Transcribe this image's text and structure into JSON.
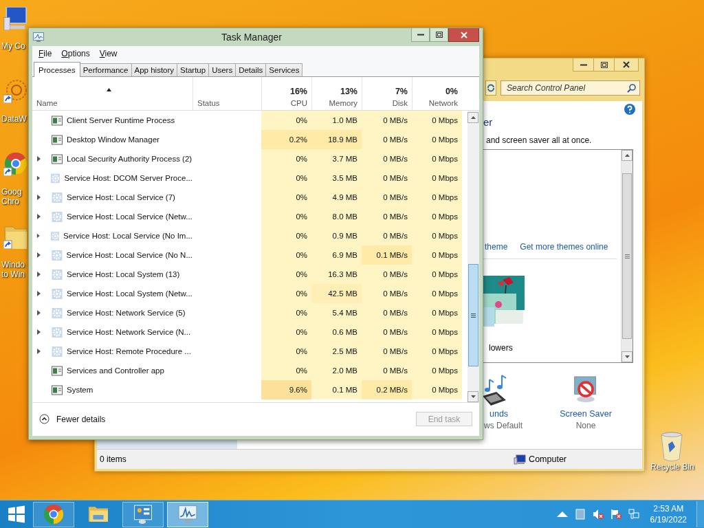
{
  "desktop_icons": [
    {
      "kind": "computer",
      "lines": [
        "My Co"
      ]
    },
    {
      "kind": "datawarehouse",
      "lines": [
        "DataW"
      ]
    },
    {
      "kind": "chrome",
      "lines": [
        "Goog",
        "Chro"
      ]
    },
    {
      "kind": "folder",
      "lines": [
        "Windo",
        "to Win"
      ]
    }
  ],
  "control_panel": {
    "search": {
      "placeholder": "Search Control Panel"
    },
    "heading": "er",
    "description": "and screen saver all at once.",
    "theme_links": [
      "theme",
      "Get more themes online"
    ],
    "theme": {
      "name": "lowers"
    },
    "settings": [
      {
        "kind": "sounds",
        "label": "unds",
        "value": "ws Default"
      },
      {
        "kind": "screen_saver",
        "label": "Screen Saver",
        "value": "None"
      }
    ],
    "status_bar": {
      "items": "0 items",
      "location": "Computer"
    }
  },
  "task_manager": {
    "title": "Task Manager",
    "menu": [
      "File",
      "Options",
      "View"
    ],
    "tabs": [
      {
        "label": "Processes",
        "selected": true
      },
      {
        "label": "Performance",
        "selected": false
      },
      {
        "label": "App history",
        "selected": false
      },
      {
        "label": "Startup",
        "selected": false
      },
      {
        "label": "Users",
        "selected": false
      },
      {
        "label": "Details",
        "selected": false
      },
      {
        "label": "Services",
        "selected": false
      }
    ],
    "name_column": {
      "label": "Name"
    },
    "status_column": {
      "label": "Status"
    },
    "metric_columns": [
      {
        "label": "CPU",
        "total": "16%"
      },
      {
        "label": "Memory",
        "total": "13%"
      },
      {
        "label": "Disk",
        "total": "7%"
      },
      {
        "label": "Network",
        "total": "0%"
      }
    ],
    "rows": [
      {
        "name": "Client Server Runtime Process",
        "kind": "window",
        "expandable": false,
        "cells": [
          {
            "text": "0%",
            "color": "#fff4c4"
          },
          {
            "text": "1.0 MB",
            "color": "#fff4c4"
          },
          {
            "text": "0 MB/s",
            "color": "#fff4c4"
          },
          {
            "text": "0 Mbps",
            "color": "#fff4c4"
          }
        ]
      },
      {
        "name": "Desktop Window Manager",
        "kind": "window",
        "expandable": false,
        "cells": [
          {
            "text": "0.2%",
            "color": "#ffeaa8"
          },
          {
            "text": "18.9 MB",
            "color": "#ffeaa8"
          },
          {
            "text": "0 MB/s",
            "color": "#fff4c4"
          },
          {
            "text": "0 Mbps",
            "color": "#fff4c4"
          }
        ]
      },
      {
        "name": "Local Security Authority Process (2)",
        "kind": "window",
        "expandable": true,
        "cells": [
          {
            "text": "0%",
            "color": "#fff4c4"
          },
          {
            "text": "3.7 MB",
            "color": "#fff4c4"
          },
          {
            "text": "0 MB/s",
            "color": "#fff4c4"
          },
          {
            "text": "0 Mbps",
            "color": "#fff4c4"
          }
        ]
      },
      {
        "name": "Service Host: DCOM Server Proce...",
        "kind": "gear",
        "expandable": true,
        "cells": [
          {
            "text": "0%",
            "color": "#fff4c4"
          },
          {
            "text": "3.5 MB",
            "color": "#fff4c4"
          },
          {
            "text": "0 MB/s",
            "color": "#fff4c4"
          },
          {
            "text": "0 Mbps",
            "color": "#fff4c4"
          }
        ]
      },
      {
        "name": "Service Host: Local Service (7)",
        "kind": "gear",
        "expandable": true,
        "cells": [
          {
            "text": "0%",
            "color": "#fff4c4"
          },
          {
            "text": "4.9 MB",
            "color": "#fff4c4"
          },
          {
            "text": "0 MB/s",
            "color": "#fff4c4"
          },
          {
            "text": "0 Mbps",
            "color": "#fff4c4"
          }
        ]
      },
      {
        "name": "Service Host: Local Service (Netw...",
        "kind": "gear",
        "expandable": true,
        "cells": [
          {
            "text": "0%",
            "color": "#fff4c4"
          },
          {
            "text": "8.0 MB",
            "color": "#fff4c4"
          },
          {
            "text": "0 MB/s",
            "color": "#fff4c4"
          },
          {
            "text": "0 Mbps",
            "color": "#fff4c4"
          }
        ]
      },
      {
        "name": "Service Host: Local Service (No Im...",
        "kind": "gear",
        "expandable": true,
        "cells": [
          {
            "text": "0%",
            "color": "#fff4c4"
          },
          {
            "text": "0.9 MB",
            "color": "#fff4c4"
          },
          {
            "text": "0 MB/s",
            "color": "#fff4c4"
          },
          {
            "text": "0 Mbps",
            "color": "#fff4c4"
          }
        ]
      },
      {
        "name": "Service Host: Local Service (No N...",
        "kind": "gear",
        "expandable": true,
        "cells": [
          {
            "text": "0%",
            "color": "#fff4c4"
          },
          {
            "text": "6.9 MB",
            "color": "#fff4c4"
          },
          {
            "text": "0.1 MB/s",
            "color": "#ffeaa8"
          },
          {
            "text": "0 Mbps",
            "color": "#fff4c4"
          }
        ]
      },
      {
        "name": "Service Host: Local System (13)",
        "kind": "gear",
        "expandable": true,
        "cells": [
          {
            "text": "0%",
            "color": "#fff4c4"
          },
          {
            "text": "16.3 MB",
            "color": "#fff4c4"
          },
          {
            "text": "0 MB/s",
            "color": "#fff4c4"
          },
          {
            "text": "0 Mbps",
            "color": "#fff4c4"
          }
        ]
      },
      {
        "name": "Service Host: Local System (Netw...",
        "kind": "gear",
        "expandable": true,
        "cells": [
          {
            "text": "0%",
            "color": "#fff4c4"
          },
          {
            "text": "42.5 MB",
            "color": "#ffefb6"
          },
          {
            "text": "0 MB/s",
            "color": "#fff4c4"
          },
          {
            "text": "0 Mbps",
            "color": "#fff4c4"
          }
        ]
      },
      {
        "name": "Service Host: Network Service (5)",
        "kind": "gear",
        "expandable": true,
        "cells": [
          {
            "text": "0%",
            "color": "#fff4c4"
          },
          {
            "text": "5.4 MB",
            "color": "#fff4c4"
          },
          {
            "text": "0 MB/s",
            "color": "#fff4c4"
          },
          {
            "text": "0 Mbps",
            "color": "#fff4c4"
          }
        ]
      },
      {
        "name": "Service Host: Network Service (N...",
        "kind": "gear",
        "expandable": true,
        "cells": [
          {
            "text": "0%",
            "color": "#fff4c4"
          },
          {
            "text": "0.6 MB",
            "color": "#fff4c4"
          },
          {
            "text": "0 MB/s",
            "color": "#fff4c4"
          },
          {
            "text": "0 Mbps",
            "color": "#fff4c4"
          }
        ]
      },
      {
        "name": "Service Host: Remote Procedure ...",
        "kind": "gear",
        "expandable": true,
        "cells": [
          {
            "text": "0%",
            "color": "#fff4c4"
          },
          {
            "text": "2.5 MB",
            "color": "#fff4c4"
          },
          {
            "text": "0 MB/s",
            "color": "#fff4c4"
          },
          {
            "text": "0 Mbps",
            "color": "#fff4c4"
          }
        ]
      },
      {
        "name": "Services and Controller app",
        "kind": "window",
        "expandable": false,
        "cells": [
          {
            "text": "0%",
            "color": "#fff4c4"
          },
          {
            "text": "2.0 MB",
            "color": "#fff4c4"
          },
          {
            "text": "0 MB/s",
            "color": "#fff4c4"
          },
          {
            "text": "0 Mbps",
            "color": "#fff4c4"
          }
        ]
      },
      {
        "name": "System",
        "kind": "window",
        "expandable": false,
        "cells": [
          {
            "text": "9.6%",
            "color": "#fde19a"
          },
          {
            "text": "0.1 MB",
            "color": "#fff4c4"
          },
          {
            "text": "0.2 MB/s",
            "color": "#ffeaa8"
          },
          {
            "text": "0 Mbps",
            "color": "#fff4c4"
          }
        ]
      }
    ],
    "footer": {
      "toggle": "Fewer details",
      "end_task": {
        "label": "End task",
        "disabled": true
      }
    }
  },
  "recycle_bin": {
    "label": "Recycle Bin"
  },
  "taskbar": {
    "items": [
      {
        "kind": "chrome",
        "open": true,
        "selected": false
      },
      {
        "kind": "explorer",
        "open": false,
        "selected": false
      },
      {
        "kind": "control_panel",
        "open": true,
        "selected": false
      },
      {
        "kind": "task_manager",
        "open": true,
        "selected": true
      }
    ],
    "clock": {
      "time": "2:53 AM",
      "date": "6/19/2022"
    }
  }
}
